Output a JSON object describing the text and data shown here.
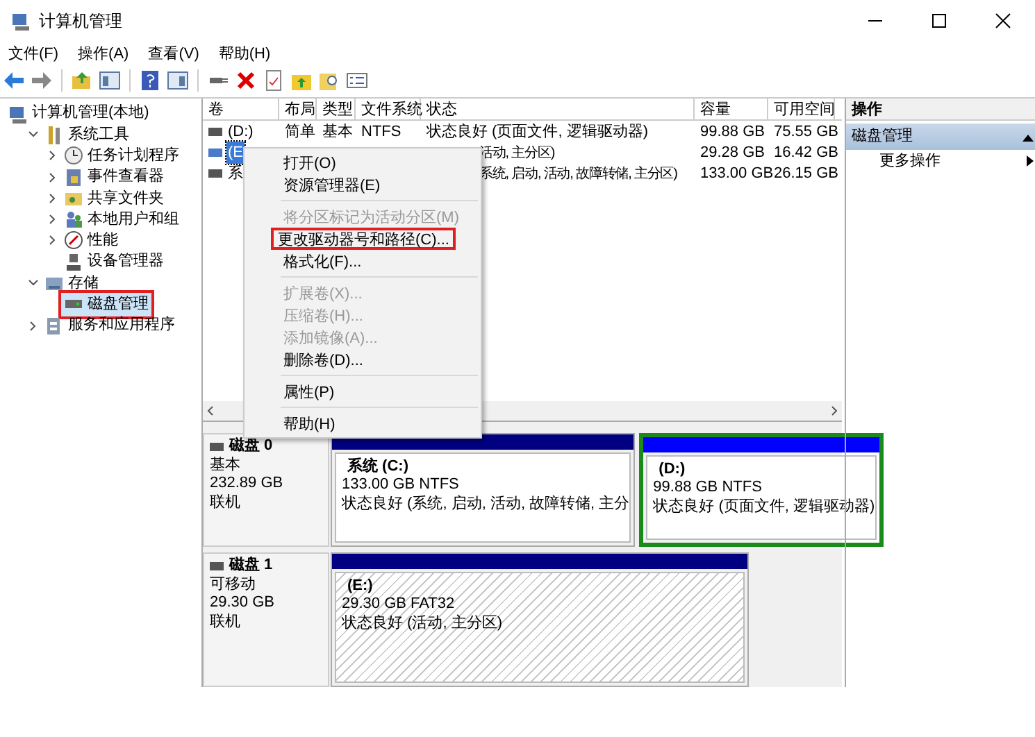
{
  "window": {
    "title": "计算机管理"
  },
  "menu_bar": [
    "文件(F)",
    "操作(A)",
    "查看(V)",
    "帮助(H)"
  ],
  "toolbar": [
    {
      "kind": "back"
    },
    {
      "kind": "forward"
    },
    {
      "kind": "sep"
    },
    {
      "kind": "up"
    },
    {
      "kind": "tree"
    },
    {
      "kind": "sep"
    },
    {
      "kind": "help"
    },
    {
      "kind": "panel"
    },
    {
      "kind": "sep"
    },
    {
      "kind": "connect"
    },
    {
      "kind": "delete"
    },
    {
      "kind": "check"
    },
    {
      "kind": "folder-up"
    },
    {
      "kind": "folder-search"
    },
    {
      "kind": "list"
    }
  ],
  "tree": {
    "label": "计算机管理(本地)",
    "children": [
      {
        "label": "系统工具",
        "expanded": true,
        "selected": false,
        "highlighted": false,
        "children": [
          {
            "label": "任务计划程序",
            "expanded": false,
            "selected": false,
            "highlighted": false
          },
          {
            "label": "事件查看器",
            "expanded": false,
            "selected": false,
            "highlighted": false
          },
          {
            "label": "共享文件夹",
            "expanded": false,
            "selected": false,
            "highlighted": false
          },
          {
            "label": "本地用户和组",
            "expanded": false,
            "selected": false,
            "highlighted": false
          },
          {
            "label": "性能",
            "expanded": false,
            "selected": false,
            "highlighted": false
          },
          {
            "label": "设备管理器",
            "selected": false,
            "highlighted": false
          }
        ]
      },
      {
        "label": "存储",
        "expanded": true,
        "selected": false,
        "highlighted": false,
        "children": [
          {
            "label": "磁盘管理",
            "selected": true,
            "highlighted": true
          }
        ]
      },
      {
        "label": "服务和应用程序",
        "expanded": false,
        "selected": false,
        "highlighted": false
      }
    ]
  },
  "table": {
    "columns": [
      "卷",
      "布局",
      "类型",
      "文件系统",
      "状态",
      "容量",
      "可用空间"
    ],
    "rows": [
      {
        "volume": "(D:)",
        "layout": "简单",
        "type": "基本",
        "file_system": "NTFS",
        "status": "状态良好 (页面文件, 逻辑驱动器)",
        "capacity": "99.88 GB",
        "free": "75.55 GB",
        "selected": false
      },
      {
        "volume": "(E",
        "status": "活动, 主分区)",
        "capacity": "29.28 GB",
        "free": "16.42 GB",
        "selected": true
      },
      {
        "volume": "系",
        "status": "系统, 启动, 活动, 故障转储, 主分区)",
        "capacity": "133.00 GB",
        "free": "26.15 GB",
        "selected": false
      }
    ]
  },
  "context_menu": [
    {
      "label": "打开(O)",
      "disabled": false,
      "highlighted": false
    },
    {
      "label": "资源管理器(E)",
      "disabled": false,
      "highlighted": false
    },
    {
      "kind": "separator"
    },
    {
      "label": "将分区标记为活动分区(M)",
      "disabled": true,
      "highlighted": false
    },
    {
      "label": "更改驱动器号和路径(C)...",
      "disabled": false,
      "highlighted": true
    },
    {
      "label": "格式化(F)...",
      "disabled": false,
      "highlighted": false
    },
    {
      "kind": "separator"
    },
    {
      "label": "扩展卷(X)...",
      "disabled": true,
      "highlighted": false
    },
    {
      "label": "压缩卷(H)...",
      "disabled": true,
      "highlighted": false
    },
    {
      "label": "添加镜像(A)...",
      "disabled": true,
      "highlighted": false
    },
    {
      "label": "删除卷(D)...",
      "disabled": false,
      "highlighted": false
    },
    {
      "kind": "separator"
    },
    {
      "label": "属性(P)",
      "disabled": false,
      "highlighted": false
    },
    {
      "kind": "separator"
    },
    {
      "label": "帮助(H)",
      "disabled": false,
      "highlighted": false
    }
  ],
  "disks": [
    {
      "name": "磁盘 0",
      "type": "基本",
      "size": "232.89 GB",
      "status": "联机",
      "partitions": [
        {
          "name": "系统  (C:)",
          "size": "133.00 GB NTFS",
          "status": "状态良好 (系统, 启动, 活动, 故障转储, 主分",
          "kind": "primary",
          "selected": false
        },
        {
          "name": "(D:)",
          "size": "99.88 GB NTFS",
          "status": "状态良好 (页面文件, 逻辑驱动器)",
          "kind": "logical",
          "selected": false
        }
      ]
    },
    {
      "name": "磁盘 1",
      "type": "可移动",
      "size": "29.30 GB",
      "status": "联机",
      "partitions": [
        {
          "name": "(E:)",
          "size": "29.30 GB FAT32",
          "status": "状态良好 (活动, 主分区)",
          "kind": "primary",
          "selected": true
        }
      ]
    }
  ],
  "actions": {
    "title": "操作",
    "section": "磁盘管理",
    "items": [
      "更多操作"
    ]
  }
}
